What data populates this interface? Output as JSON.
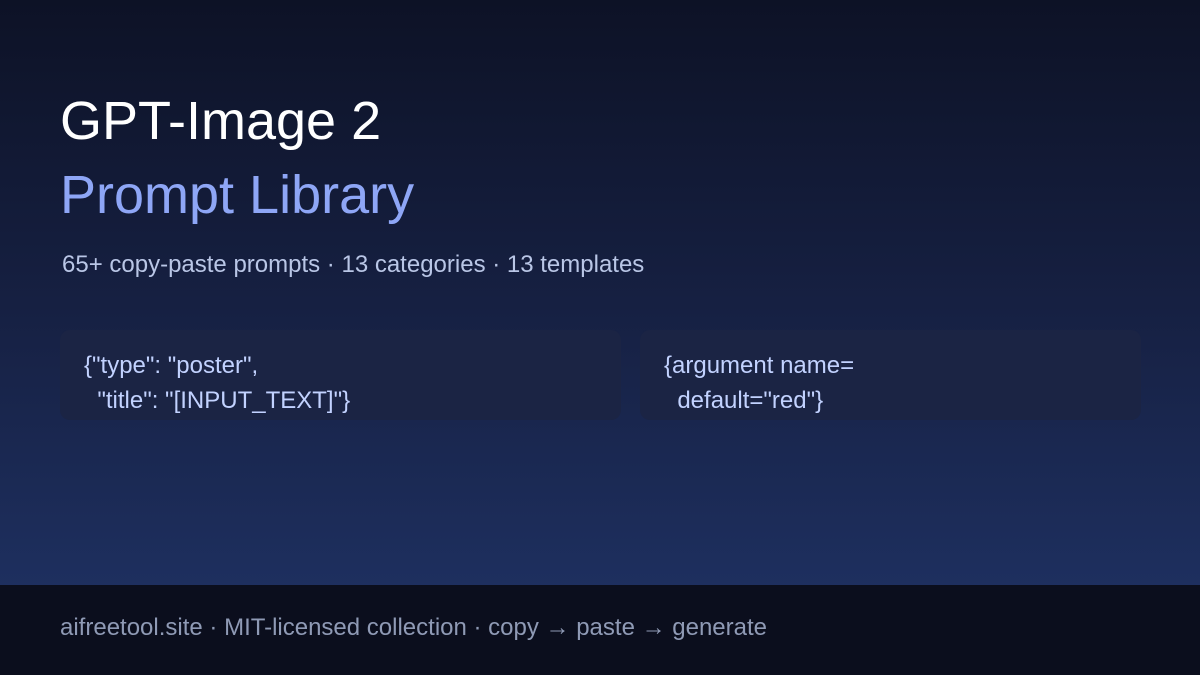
{
  "hero": {
    "title": "GPT-Image 2",
    "subtitle": "Prompt Library",
    "stats": "65+ copy-paste prompts · 13 categories · 13 templates"
  },
  "cards": [
    {
      "code": "{\"type\": \"poster\",\n  \"title\": \"[INPUT_TEXT]\"}"
    },
    {
      "code": "{argument name=\n  default=\"red\"}"
    }
  ],
  "footer": {
    "text": "aifreetool.site · MIT-licensed collection · copy → paste → generate"
  }
}
